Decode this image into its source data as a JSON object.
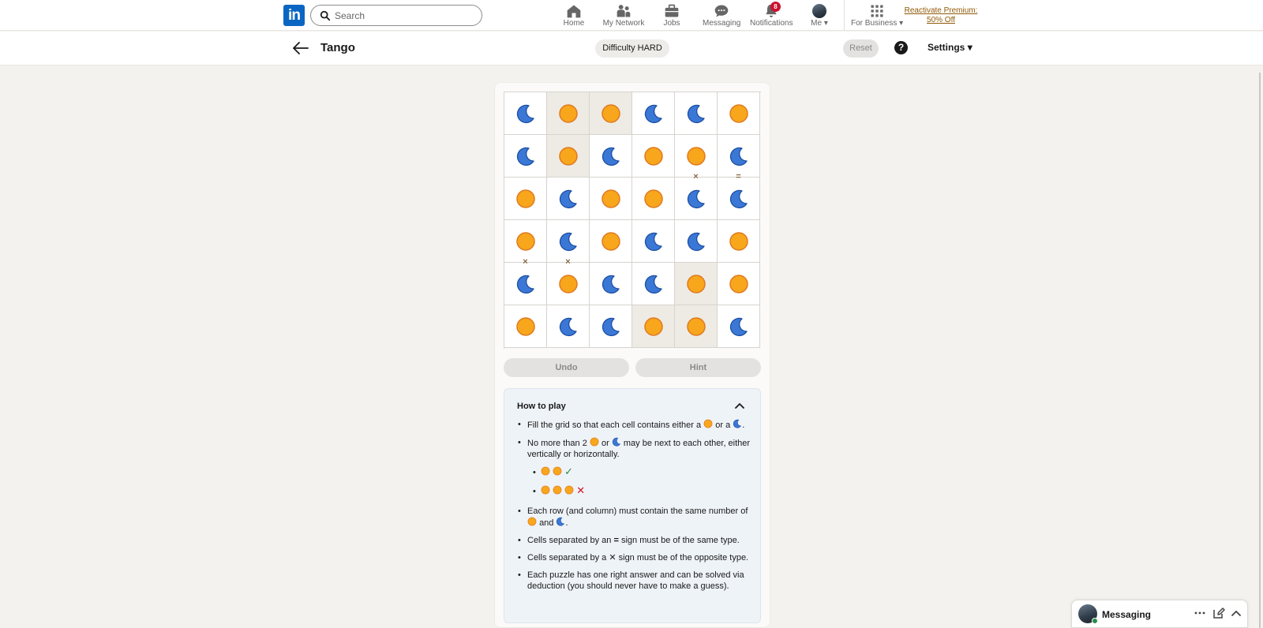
{
  "nav": {
    "logo": "in",
    "search_placeholder": "Search",
    "items": [
      {
        "label": "Home",
        "icon": "home-icon"
      },
      {
        "label": "My Network",
        "icon": "network-icon"
      },
      {
        "label": "Jobs",
        "icon": "briefcase-icon"
      },
      {
        "label": "Messaging",
        "icon": "chat-icon"
      },
      {
        "label": "Notifications",
        "icon": "bell-icon",
        "badge": "8"
      },
      {
        "label": "Me",
        "icon": "avatar"
      },
      {
        "label": "For Business",
        "icon": "grid-icon"
      }
    ],
    "premium_line1": "Reactivate Premium:",
    "premium_line2": "50% Off"
  },
  "game": {
    "title": "Tango",
    "difficulty": "Difficulty HARD",
    "reset_label": "Reset",
    "help_label": "?",
    "settings_label": "Settings",
    "undo_label": "Undo",
    "hint_label": "Hint",
    "grid": [
      [
        "moon",
        "sun",
        "sun",
        "moon",
        "moon",
        "sun"
      ],
      [
        "moon",
        "sun",
        "moon",
        "sun",
        "sun",
        "moon"
      ],
      [
        "sun",
        "moon",
        "sun",
        "sun",
        "moon",
        "moon"
      ],
      [
        "sun",
        "moon",
        "sun",
        "moon",
        "moon",
        "sun"
      ],
      [
        "moon",
        "sun",
        "moon",
        "moon",
        "sun",
        "sun"
      ],
      [
        "sun",
        "moon",
        "moon",
        "sun",
        "sun",
        "moon"
      ]
    ],
    "locked": [
      [
        0,
        1
      ],
      [
        0,
        2
      ],
      [
        1,
        1
      ],
      [
        4,
        4
      ],
      [
        5,
        3
      ],
      [
        5,
        4
      ]
    ],
    "separators": [
      {
        "between": [
          [
            1,
            4
          ],
          [
            2,
            4
          ]
        ],
        "sign": "×"
      },
      {
        "between": [
          [
            1,
            5
          ],
          [
            2,
            5
          ]
        ],
        "sign": "="
      },
      {
        "between": [
          [
            3,
            0
          ],
          [
            4,
            0
          ]
        ],
        "sign": "×"
      },
      {
        "between": [
          [
            3,
            1
          ],
          [
            4,
            1
          ]
        ],
        "sign": "×"
      }
    ],
    "colors": {
      "sun": "#f8a61c",
      "sun_stroke": "#e07a1f",
      "moon": "#3b78d6",
      "moon_stroke": "#1c4fa3"
    }
  },
  "howto": {
    "title": "How to play",
    "r1_a": "Fill the grid so that each cell contains either a",
    "r1_b": "or a",
    "r1_c": ".",
    "r2_a": "No more than 2",
    "r2_b": "or",
    "r2_c": "may be next to each other, either vertically or horizontally.",
    "ok_mark": "✓",
    "bad_mark": "✕",
    "r3_a": "Each row (and column) must contain the same number of",
    "r3_b": "and",
    "r3_c": ".",
    "r4_a": "Cells separated by an",
    "r4_sign": "=",
    "r4_b": "sign must be of the same type.",
    "r5_a": "Cells separated by a",
    "r5_sign": "✕",
    "r5_b": "sign must be of the opposite type.",
    "r6": "Each puzzle has one right answer and can be solved via deduction (you should never have to make a guess)."
  },
  "messaging": {
    "label": "Messaging"
  }
}
